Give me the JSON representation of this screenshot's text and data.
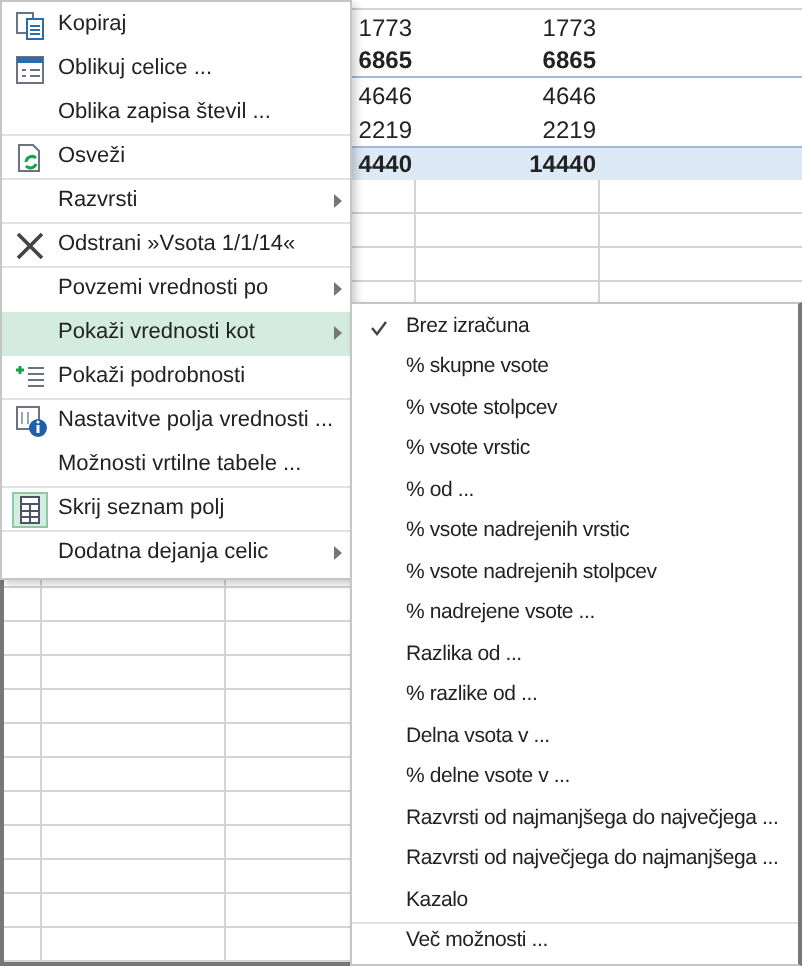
{
  "sheet": {
    "rows": [
      {
        "cells": [
          "1773",
          "1773"
        ],
        "kind": "data"
      },
      {
        "cells": [
          "6865",
          "6865"
        ],
        "kind": "subtotal"
      },
      {
        "cells": [
          "4646",
          "4646"
        ],
        "kind": "data"
      },
      {
        "cells": [
          "2219",
          "2219"
        ],
        "kind": "data"
      },
      {
        "cells": [
          "4440",
          "14440"
        ],
        "kind": "total"
      }
    ]
  },
  "context_menu": {
    "items": [
      {
        "label": "Kopiraj",
        "kind": "copy",
        "submenu": false,
        "selected": false,
        "separator_after": false
      },
      {
        "label": "Oblikuj celice ...",
        "kind": "format",
        "submenu": false,
        "selected": false,
        "separator_after": false
      },
      {
        "label": "Oblika zapisa števil ...",
        "kind": "plain",
        "submenu": false,
        "selected": false,
        "separator_after": true
      },
      {
        "label": "Osveži",
        "kind": "refresh",
        "submenu": false,
        "selected": false,
        "separator_after": true
      },
      {
        "label": "Razvrsti",
        "kind": "plain",
        "submenu": true,
        "selected": false,
        "separator_after": true
      },
      {
        "label": "Odstrani »Vsota 1/1/14«",
        "kind": "remove",
        "submenu": false,
        "selected": false,
        "separator_after": true
      },
      {
        "label": "Povzemi vrednosti po",
        "kind": "plain",
        "submenu": true,
        "selected": false,
        "separator_after": false
      },
      {
        "label": "Pokaži vrednosti kot",
        "kind": "plain",
        "submenu": true,
        "selected": true,
        "separator_after": false
      },
      {
        "label": "Pokaži podrobnosti",
        "kind": "details",
        "submenu": false,
        "selected": false,
        "separator_after": true
      },
      {
        "label": "Nastavitve polja vrednosti ...",
        "kind": "settings",
        "submenu": false,
        "selected": false,
        "separator_after": false
      },
      {
        "label": "Možnosti vrtilne tabele ...",
        "kind": "plain",
        "submenu": false,
        "selected": false,
        "separator_after": true
      },
      {
        "label": "Skrij seznam polj",
        "kind": "fieldlist",
        "submenu": false,
        "selected": false,
        "separator_after": true
      },
      {
        "label": "Dodatna dejanja celic",
        "kind": "plain",
        "submenu": true,
        "selected": false,
        "separator_after": false
      }
    ]
  },
  "submenu": {
    "items": [
      {
        "label": "Brez izračuna",
        "checked": true,
        "separator_after": false
      },
      {
        "label": "% skupne vsote",
        "checked": false,
        "separator_after": false
      },
      {
        "label": "% vsote stolpcev",
        "checked": false,
        "separator_after": false
      },
      {
        "label": "% vsote vrstic",
        "checked": false,
        "separator_after": false
      },
      {
        "label": "% od ...",
        "checked": false,
        "separator_after": false
      },
      {
        "label": "% vsote nadrejenih vrstic",
        "checked": false,
        "separator_after": false
      },
      {
        "label": "% vsote nadrejenih stolpcev",
        "checked": false,
        "separator_after": false
      },
      {
        "label": "% nadrejene vsote ...",
        "checked": false,
        "separator_after": false
      },
      {
        "label": "Razlika od ...",
        "checked": false,
        "separator_after": false
      },
      {
        "label": "% razlike od ...",
        "checked": false,
        "separator_after": false
      },
      {
        "label": "Delna vsota v ...",
        "checked": false,
        "separator_after": false
      },
      {
        "label": "% delne vsote v ...",
        "checked": false,
        "separator_after": false
      },
      {
        "label": "Razvrsti od najmanjšega do največjega ...",
        "checked": false,
        "separator_after": false
      },
      {
        "label": "Razvrsti od največjega do najmanjšega ...",
        "checked": false,
        "separator_after": false
      },
      {
        "label": "Kazalo",
        "checked": false,
        "separator_after": true
      },
      {
        "label": "Več možnosti ...",
        "checked": false,
        "separator_after": false
      }
    ]
  }
}
